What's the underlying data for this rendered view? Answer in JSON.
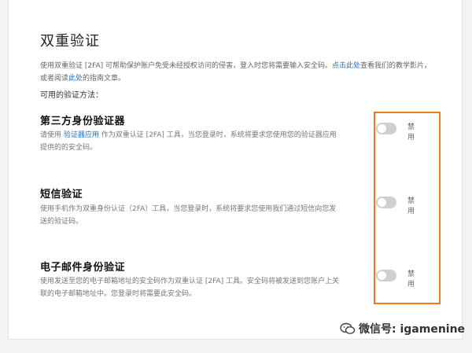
{
  "page": {
    "title": "双重验证",
    "intro_before": "使用双重验证 [2FA] 可帮助保护账户免受未经授权访问的侵害，登入时您将需要输入安全码。",
    "intro_link1": "点击此处",
    "intro_middle": "查看我们的教学影片，或者阅读",
    "intro_link2": "此处",
    "intro_after": "的指南文章。",
    "available_label": "可用的验证方法："
  },
  "methods": [
    {
      "title": "第三方身份验证器",
      "desc_before": "请使用 ",
      "desc_link": "验证器应用",
      "desc_after": " 作为双重认证 [2FA] 工具，当您登录时，系统将要求您使用您的验证器应用提供的的安全码。",
      "toggle_label": "禁用",
      "enabled": false
    },
    {
      "title": "短信验证",
      "desc": "使用手机作为双重身份认证（2FA）工具，当您登录时，系统将要求您使用我们通过短信向您发送的验证码。",
      "toggle_label": "禁用",
      "enabled": false
    },
    {
      "title": "电子邮件身份验证",
      "desc": "使用发送至您的电子邮箱地址的安全码作为双重认证 [2FA] 工具。安全码将被发送到您账户上关联的电子邮箱地址中。您登录时将需要此安全码。",
      "toggle_label": "禁用",
      "enabled": false
    }
  ],
  "watermark": {
    "icon": "wechat-icon",
    "text": "微信号: igamenine"
  },
  "colors": {
    "highlight": "#f07a1f",
    "link": "#2b6fb8",
    "toggle_off": "#cfcfcf"
  }
}
